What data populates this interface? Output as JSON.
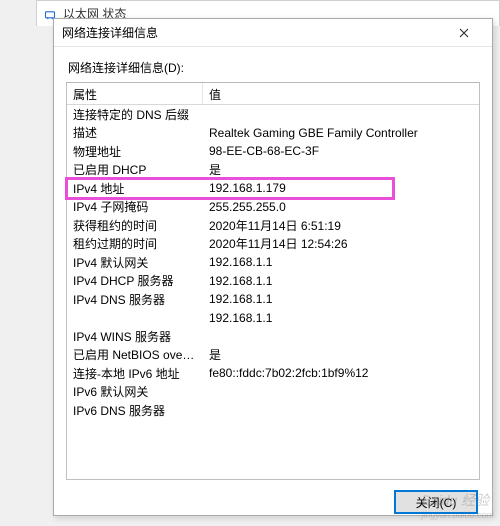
{
  "outer": {
    "title": "以太网 状态"
  },
  "dialog": {
    "title": "网络连接详细信息",
    "list_label": "网络连接详细信息(D):",
    "columns": {
      "prop": "属性",
      "val": "值"
    },
    "rows": [
      {
        "prop": "连接特定的 DNS 后缀",
        "val": ""
      },
      {
        "prop": "描述",
        "val": "Realtek Gaming GBE Family Controller"
      },
      {
        "prop": "物理地址",
        "val": "98-EE-CB-68-EC-3F"
      },
      {
        "prop": "已启用 DHCP",
        "val": "是"
      },
      {
        "prop": "IPv4 地址",
        "val": "192.168.1.179"
      },
      {
        "prop": "IPv4 子网掩码",
        "val": "255.255.255.0"
      },
      {
        "prop": "获得租约的时间",
        "val": "2020年11月14日 6:51:19"
      },
      {
        "prop": "租约过期的时间",
        "val": "2020年11月14日 12:54:26"
      },
      {
        "prop": "IPv4 默认网关",
        "val": "192.168.1.1"
      },
      {
        "prop": "IPv4 DHCP 服务器",
        "val": "192.168.1.1"
      },
      {
        "prop": "IPv4 DNS 服务器",
        "val": "192.168.1.1"
      },
      {
        "prop": "",
        "val": "192.168.1.1"
      },
      {
        "prop": "IPv4 WINS 服务器",
        "val": ""
      },
      {
        "prop": "已启用 NetBIOS over Tc...",
        "val": "是"
      },
      {
        "prop": "连接-本地 IPv6 地址",
        "val": "fe80::fddc:7b02:2fcb:1bf9%12"
      },
      {
        "prop": "IPv6 默认网关",
        "val": ""
      },
      {
        "prop": "IPv6 DNS 服务器",
        "val": ""
      }
    ],
    "highlight_row_index": 4,
    "close_button": "关闭(C)"
  },
  "watermark": {
    "main": "Baidu 经验",
    "sub": "jingyan.baidu.com"
  }
}
